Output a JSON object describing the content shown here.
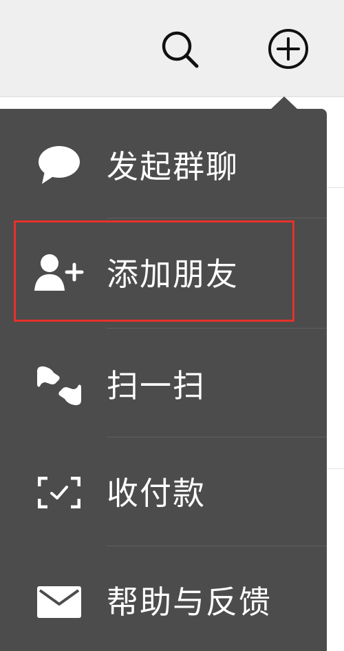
{
  "header": {
    "search_icon": "search-icon",
    "add_icon": "plus-circle-icon"
  },
  "menu": {
    "items": [
      {
        "label": "发起群聊",
        "icon": "chat-bubble-icon"
      },
      {
        "label": "添加朋友",
        "icon": "add-user-icon"
      },
      {
        "label": "扫一扫",
        "icon": "scan-icon"
      },
      {
        "label": "收付款",
        "icon": "payment-scan-icon"
      },
      {
        "label": "帮助与反馈",
        "icon": "mail-icon"
      }
    ],
    "highlighted_item": "添加朋友"
  },
  "colors": {
    "menu_bg": "#4c4c4c",
    "topbar_bg": "#efefef",
    "highlight_border": "#e6322b",
    "text": "#ffffff"
  }
}
